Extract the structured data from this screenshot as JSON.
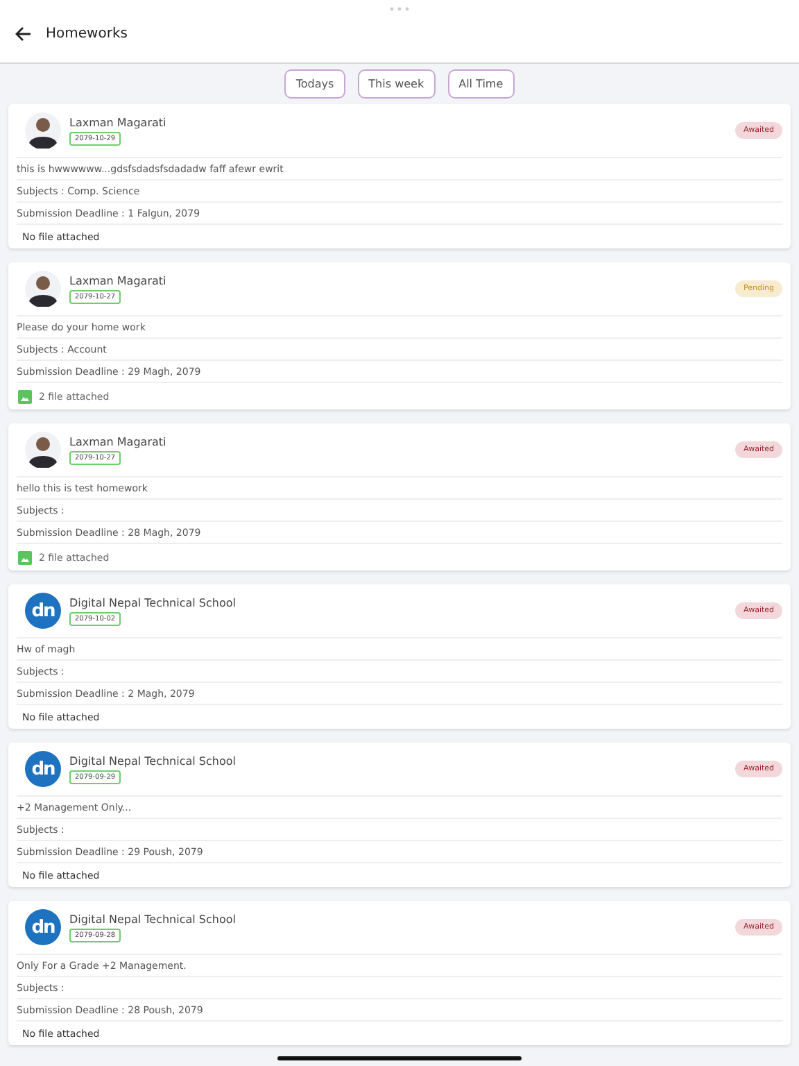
{
  "header": {
    "title": "Homeworks"
  },
  "filters": [
    {
      "label": "Todays"
    },
    {
      "label": "This week"
    },
    {
      "label": "All Time"
    }
  ],
  "homeworks": [
    {
      "avatar": {
        "kind": "person"
      },
      "author": "Laxman Magarati",
      "date": "2079-10-29",
      "status": {
        "label": "Awaited",
        "kind": "awaited"
      },
      "description": "this is hwwwwww...gdsfsdadsfsdadadw faff afewr ewrit",
      "subjects": "Subjects : Comp. Science",
      "deadline": "Submission Deadline : 1 Falgun, 2079",
      "attachment": {
        "text": "No file attached",
        "has_files": false
      }
    },
    {
      "avatar": {
        "kind": "person"
      },
      "author": "Laxman Magarati",
      "date": "2079-10-27",
      "status": {
        "label": "Pending",
        "kind": "pending"
      },
      "description": "Please do your home work",
      "subjects": "Subjects : Account",
      "deadline": "Submission Deadline : 29 Magh, 2079",
      "attachment": {
        "text": "2 file attached",
        "has_files": true
      }
    },
    {
      "avatar": {
        "kind": "person"
      },
      "author": "Laxman Magarati",
      "date": "2079-10-27",
      "status": {
        "label": "Awaited",
        "kind": "awaited"
      },
      "description": "hello this is test homework",
      "subjects": "Subjects :",
      "deadline": "Submission Deadline : 28 Magh, 2079",
      "attachment": {
        "text": "2 file attached",
        "has_files": true
      }
    },
    {
      "avatar": {
        "kind": "logo",
        "text": "dn"
      },
      "author": "Digital Nepal Technical School",
      "date": "2079-10-02",
      "status": {
        "label": "Awaited",
        "kind": "awaited"
      },
      "description": "Hw of magh",
      "subjects": "Subjects :",
      "deadline": "Submission Deadline : 2 Magh, 2079",
      "attachment": {
        "text": "No file attached",
        "has_files": false
      }
    },
    {
      "avatar": {
        "kind": "logo",
        "text": "dn"
      },
      "author": "Digital Nepal Technical School",
      "date": "2079-09-29",
      "status": {
        "label": "Awaited",
        "kind": "awaited"
      },
      "description": "+2 Management Only...",
      "subjects": "Subjects :",
      "deadline": "Submission Deadline : 29 Poush, 2079",
      "attachment": {
        "text": "No file attached",
        "has_files": false
      }
    },
    {
      "avatar": {
        "kind": "logo",
        "text": "dn"
      },
      "author": "Digital Nepal Technical School",
      "date": "2079-09-28",
      "status": {
        "label": "Awaited",
        "kind": "awaited"
      },
      "description": "Only For a Grade +2 Management.",
      "subjects": "Subjects :",
      "deadline": "Submission Deadline : 28 Poush, 2079",
      "attachment": {
        "text": "No file attached",
        "has_files": false
      }
    }
  ]
}
